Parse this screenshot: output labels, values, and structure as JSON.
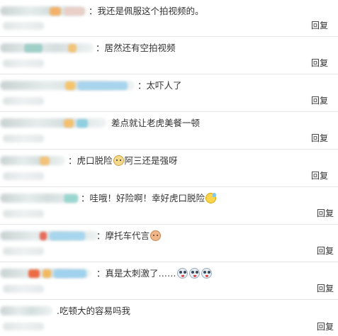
{
  "reply_label": "回复",
  "comments": [
    {
      "separator": "：",
      "text": "我还是佩服这个拍视频的。",
      "emojis": []
    },
    {
      "separator": "：",
      "text": "居然还有空拍视频",
      "emojis": []
    },
    {
      "separator": "：",
      "text": "太吓人了",
      "emojis": []
    },
    {
      "separator": "：",
      "text": "差点就让老虎美餐一顿",
      "emojis": []
    },
    {
      "separator": "：",
      "text_before": "虎口脱险",
      "text_after": "阿三还是强呀",
      "emojis": [
        "tiger-face-icon"
      ]
    },
    {
      "separator": "：",
      "text": "哇哦！好险啊！幸好虎口脱险",
      "emojis": [
        "sweat-face-icon"
      ]
    },
    {
      "separator": "：",
      "text": "摩托车代言",
      "emojis": [
        "shy-face-icon"
      ]
    },
    {
      "separator": "：",
      "text": "真是太刺激了……",
      "emojis": [
        "crazy-face-icon",
        "crazy-face-icon",
        "crazy-face-icon"
      ]
    },
    {
      "separator": ".",
      "text": "吃顿大的容易吗我",
      "emojis": []
    }
  ],
  "colors": {
    "text": "#333333",
    "divider": "#e4e4e4",
    "background": "#ffffff"
  }
}
